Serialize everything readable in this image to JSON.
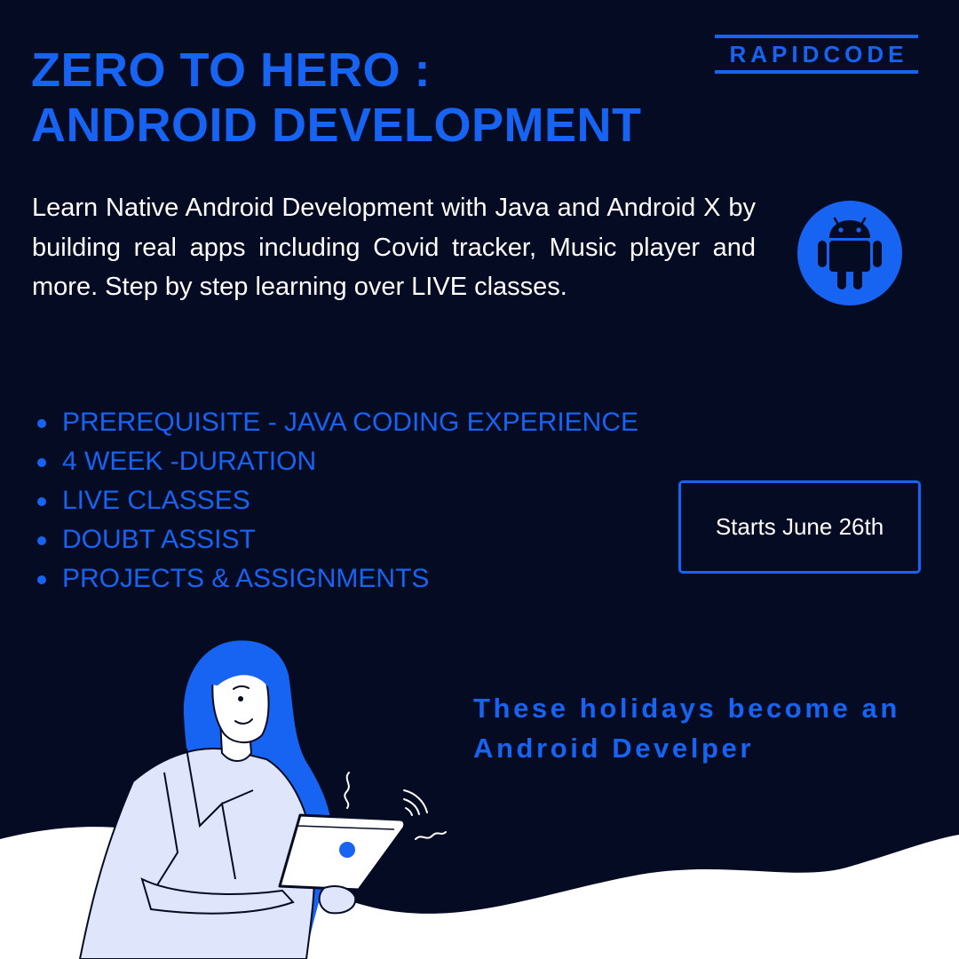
{
  "brand": {
    "name": "RAPIDCODE"
  },
  "title": {
    "line1": "ZERO TO HERO :",
    "line2": "ANDROID DEVELOPMENT"
  },
  "description": "Learn Native Android Development with Java and Android X  by building real apps including Covid tracker, Music player and more. Step by step learning over LIVE classes.",
  "icon": {
    "android": "android-icon"
  },
  "features": [
    "PREREQUISITE - JAVA CODING EXPERIENCE",
    "4 WEEK -DURATION",
    "LIVE CLASSES",
    "DOUBT ASSIST",
    "PROJECTS & ASSIGNMENTS"
  ],
  "start": {
    "label": "Starts June 26th"
  },
  "tagline": {
    "line1": "These holidays become an",
    "line2": "Android Develper"
  },
  "colors": {
    "background": "#050b22",
    "accent": "#1763f2",
    "text": "#ffffff",
    "illustration": "#dfe6fb"
  }
}
